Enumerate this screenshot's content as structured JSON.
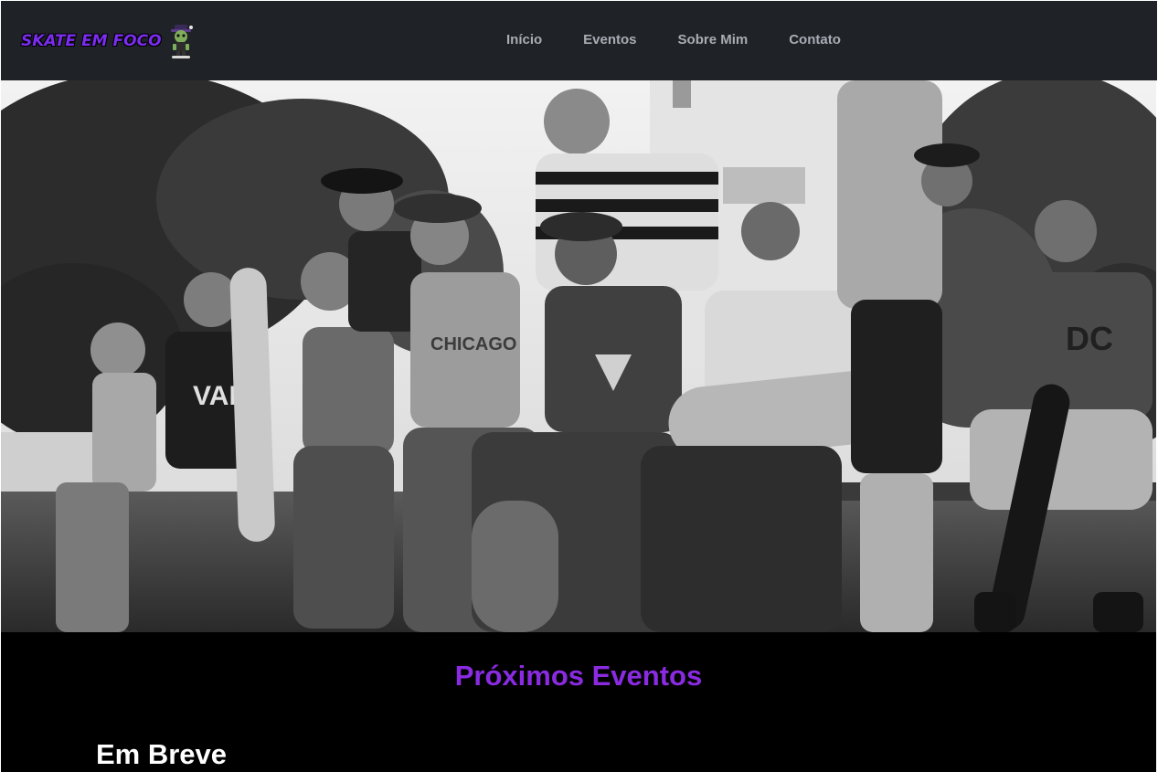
{
  "header": {
    "logo_text": "SKATE EM FOCO",
    "nav": [
      {
        "label": "Início"
      },
      {
        "label": "Eventos"
      },
      {
        "label": "Sobre Mim"
      },
      {
        "label": "Contato"
      }
    ]
  },
  "hero": {
    "image_icon": "skaters-group-photo",
    "style": "black-and-white"
  },
  "events": {
    "title": "Próximos Eventos",
    "subtitle": "Em Breve"
  },
  "colors": {
    "header_bg": "#1f2227",
    "accent": "#8a2be2",
    "nav_text": "#a9acb3",
    "section_bg": "#000000"
  }
}
